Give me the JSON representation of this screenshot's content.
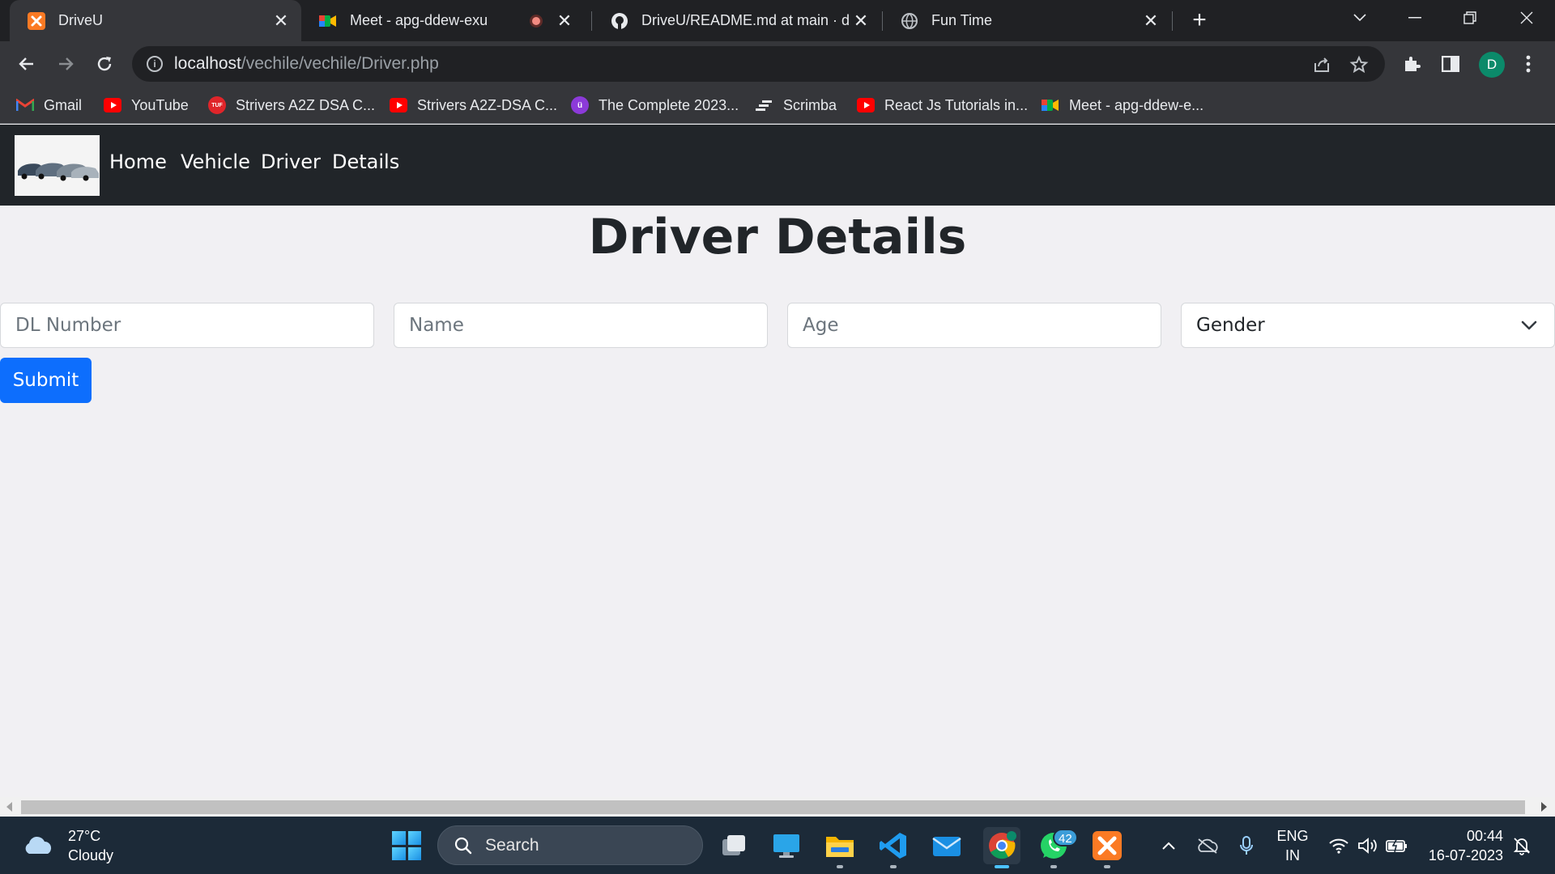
{
  "browser": {
    "tabs": [
      {
        "title": "DriveU"
      },
      {
        "title": "Meet - apg-ddew-exu"
      },
      {
        "title": "DriveU/README.md at main · div"
      },
      {
        "title": "Fun Time"
      }
    ],
    "url": {
      "host": "localhost",
      "path": "/vechile/vechile/Driver.php"
    },
    "profile_initial": "D",
    "bookmarks": [
      {
        "label": "Gmail"
      },
      {
        "label": "YouTube"
      },
      {
        "label": "Strivers A2Z DSA C..."
      },
      {
        "label": "Strivers A2Z-DSA C..."
      },
      {
        "label": "The Complete 2023..."
      },
      {
        "label": "Scrimba"
      },
      {
        "label": "React Js Tutorials in..."
      },
      {
        "label": "Meet - apg-ddew-e..."
      }
    ]
  },
  "site": {
    "nav": [
      "Home",
      "Vehicle",
      "Driver",
      "Details"
    ]
  },
  "page": {
    "title": "Driver Details",
    "fields": {
      "dl_placeholder": "DL Number",
      "name_placeholder": "Name",
      "age_placeholder": "Age",
      "gender_selected": "Gender"
    },
    "submit_label": "Submit"
  },
  "taskbar": {
    "weather_temp": "27°C",
    "weather_desc": "Cloudy",
    "search_label": "Search",
    "whatsapp_badge": "42",
    "lang_line1": "ENG",
    "lang_line2": "IN",
    "time": "00:44",
    "date": "16-07-2023"
  }
}
